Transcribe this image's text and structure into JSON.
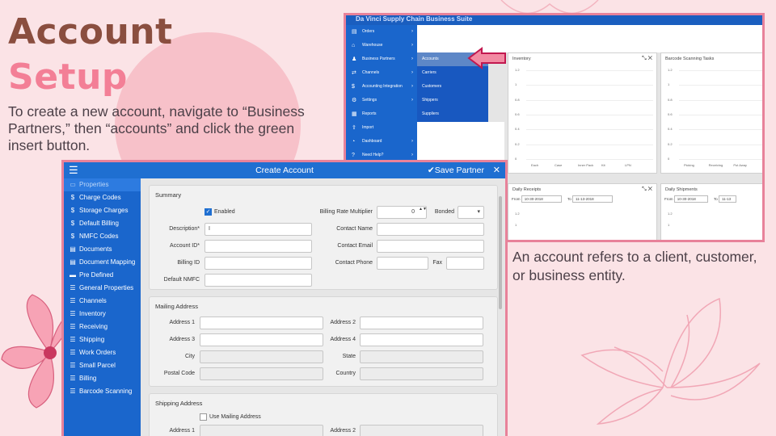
{
  "slide": {
    "title_line1": "Account",
    "title_line2": "Setup",
    "intro": "To create a new account, navigate to “Business Partners,” then “accounts” and click the green insert button.",
    "note": "An account refers to a client, customer, or business entity."
  },
  "colors": {
    "title_brown": "#8a4e3f",
    "title_pink": "#f37f96",
    "app_blue": "#1a66cc",
    "frame_pink": "#e8829a"
  },
  "suite": {
    "title": "Da Vinci Supply Chain Business Suite",
    "nav": [
      {
        "label": "Orders",
        "icon": "box-icon",
        "glyph": "▤",
        "arrow": "›"
      },
      {
        "label": "Warehouse",
        "icon": "warehouse-icon",
        "glyph": "⌂",
        "arrow": "›"
      },
      {
        "label": "Business Partners",
        "icon": "users-icon",
        "glyph": "♟",
        "arrow": "›"
      },
      {
        "label": "Channels",
        "icon": "channels-icon",
        "glyph": "⇄",
        "arrow": "›"
      },
      {
        "label": "Accounting Integration",
        "icon": "dollar-icon",
        "glyph": "$",
        "arrow": "›"
      },
      {
        "label": "Settings",
        "icon": "gear-icon",
        "glyph": "⚙",
        "arrow": "›"
      },
      {
        "label": "Reports",
        "icon": "report-icon",
        "glyph": "▦",
        "arrow": ""
      },
      {
        "label": "Import",
        "icon": "import-icon",
        "glyph": "⇪",
        "arrow": ""
      },
      {
        "label": "Dashboard",
        "icon": "dashboard-icon",
        "glyph": "◔",
        "arrow": "›"
      },
      {
        "label": "Need Help?",
        "icon": "help-icon",
        "glyph": "?",
        "arrow": "›"
      }
    ],
    "submenu": [
      "Accounts",
      "Carriers",
      "Customers",
      "Shippers",
      "Suppliers"
    ],
    "inventory": {
      "title": "Inventory",
      "controls": "⤡ ✕",
      "y_ticks": [
        "1.2",
        "1",
        "0.8",
        "0.6",
        "0.4",
        "0.2",
        "0"
      ],
      "x_ticks": [
        "Each",
        "Case",
        "Inner Pack",
        "Kit",
        "LPN"
      ]
    },
    "barcode": {
      "title": "Barcode Scanning Tasks",
      "y_ticks": [
        "1.2",
        "1",
        "0.8",
        "0.6",
        "0.4",
        "0.2",
        "0"
      ],
      "x_ticks": [
        "Picking",
        "Receiving",
        "Put Away"
      ]
    },
    "receipts": {
      "title": "Daily Receipts",
      "controls": "⤡ ✕",
      "from_label": "From",
      "from": "10-30-2018",
      "to_label": "To",
      "to": "11-13-2018",
      "y_ticks": [
        "1.2",
        "1"
      ]
    },
    "shipments": {
      "title": "Daily Shipments",
      "from_label": "From",
      "from": "10-30-2018",
      "to_label": "To",
      "to": "11-13"
    }
  },
  "create_account": {
    "title": "Create Account",
    "save": "✔Save Partner",
    "close": "✕",
    "menu": "☰",
    "sidebar": [
      {
        "label": "Properties",
        "icon": "properties-icon",
        "glyph": "▭",
        "selected": true
      },
      {
        "label": "Charge Codes",
        "icon": "dollar-icon",
        "glyph": "$"
      },
      {
        "label": "Storage Charges",
        "icon": "dollar-icon",
        "glyph": "$"
      },
      {
        "label": "Default Billing",
        "icon": "dollar-icon",
        "glyph": "$"
      },
      {
        "label": "NMFC Codes",
        "icon": "dollar-icon",
        "glyph": "$"
      },
      {
        "label": "Documents",
        "icon": "document-icon",
        "glyph": "▤"
      },
      {
        "label": "Document Mapping",
        "icon": "document-icon",
        "glyph": "▤"
      },
      {
        "label": "Pre Defined",
        "icon": "card-icon",
        "glyph": "▬"
      },
      {
        "label": "General Properties",
        "icon": "list-icon",
        "glyph": "☰"
      },
      {
        "label": "Channels",
        "icon": "list-icon",
        "glyph": "☰"
      },
      {
        "label": "Inventory",
        "icon": "list-icon",
        "glyph": "☰"
      },
      {
        "label": "Receiving",
        "icon": "list-icon",
        "glyph": "☰"
      },
      {
        "label": "Shipping",
        "icon": "list-icon",
        "glyph": "☰"
      },
      {
        "label": "Work Orders",
        "icon": "list-icon",
        "glyph": "☰"
      },
      {
        "label": "Small Parcel",
        "icon": "list-icon",
        "glyph": "☰"
      },
      {
        "label": "Billing",
        "icon": "list-icon",
        "glyph": "☰"
      },
      {
        "label": "Barcode Scanning",
        "icon": "list-icon",
        "glyph": "☰"
      }
    ],
    "summary": {
      "title": "Summary",
      "enabled": "Enabled",
      "billing_rate_multiplier": "Billing Rate Multiplier",
      "billing_rate_value": "0",
      "stepper": "▲▼",
      "bonded": "Bonded",
      "bonded_caret": "▾",
      "description": "Description*",
      "description_value": "I",
      "account_id": "Account ID*",
      "billing_id": "Billing ID",
      "default_nmfc": "Default NMFC",
      "contact_name": "Contact Name",
      "contact_email": "Contact Email",
      "contact_phone": "Contact Phone",
      "fax": "Fax"
    },
    "mailing": {
      "title": "Mailing Address",
      "address1": "Address 1",
      "address2": "Address 2",
      "address3": "Address 3",
      "address4": "Address 4",
      "city": "City",
      "state": "State",
      "postal": "Postal Code",
      "country": "Country"
    },
    "shipping": {
      "title": "Shipping Address",
      "use_mailing": "Use Mailing Address",
      "address1": "Address 1",
      "address2": "Address 2"
    }
  }
}
